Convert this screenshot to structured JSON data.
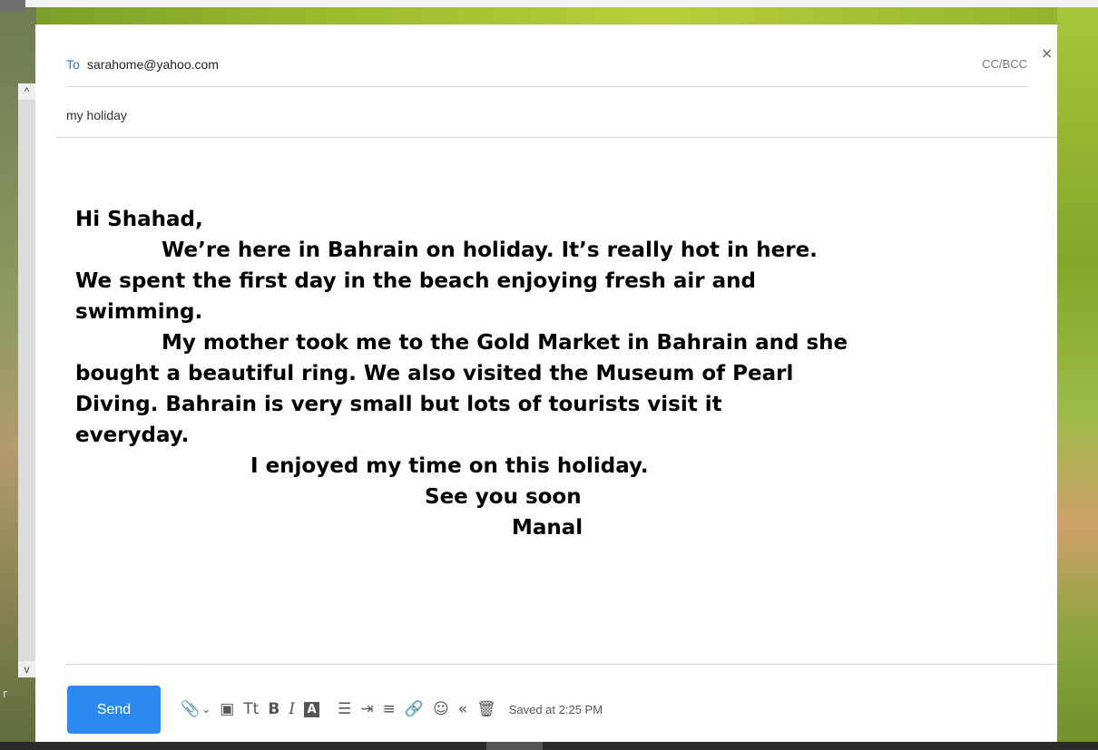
{
  "compose": {
    "to_label": "To",
    "to_email": "sarahome@yahoo.com",
    "ccbcc_label": "CC/BCC",
    "close_symbol": "×",
    "subject": "my holiday",
    "body_lines": [
      "Hi Shahad,",
      "We’re here in Bahrain on holiday. It’s really hot in here.",
      "We spent the first day in the beach enjoying fresh air and",
      "swimming.",
      "My mother took me to the Gold Market in Bahrain and she",
      "bought a beautiful ring. We also visited the Museum of Pearl",
      "Diving. Bahrain is very small but lots of tourists visit it",
      "everyday.",
      "I enjoyed my time on this holiday.",
      "See you soon",
      "Manal"
    ]
  },
  "toolbar": {
    "send_label": "Send",
    "saved_text": "Saved at 2:25 PM",
    "icons": {
      "attach": "paperclip-icon",
      "attach_more": "chevron-down-icon",
      "stationery": "stationery-icon",
      "font_size": "Tt",
      "bold": "B",
      "italic": "I",
      "highlight": "A",
      "bullets": "bullet-list-icon",
      "indent": "indent-icon",
      "align": "align-icon",
      "link": "link-icon",
      "emoji": "emoji-icon",
      "rich_text": "double-chevron-left-icon",
      "delete": "trash-icon"
    }
  },
  "window": {
    "scroll_up": "^",
    "scroll_down": "v",
    "left_letter": "r"
  },
  "colors": {
    "accent": "#2d89ef",
    "to_label": "#2b6fd8"
  }
}
